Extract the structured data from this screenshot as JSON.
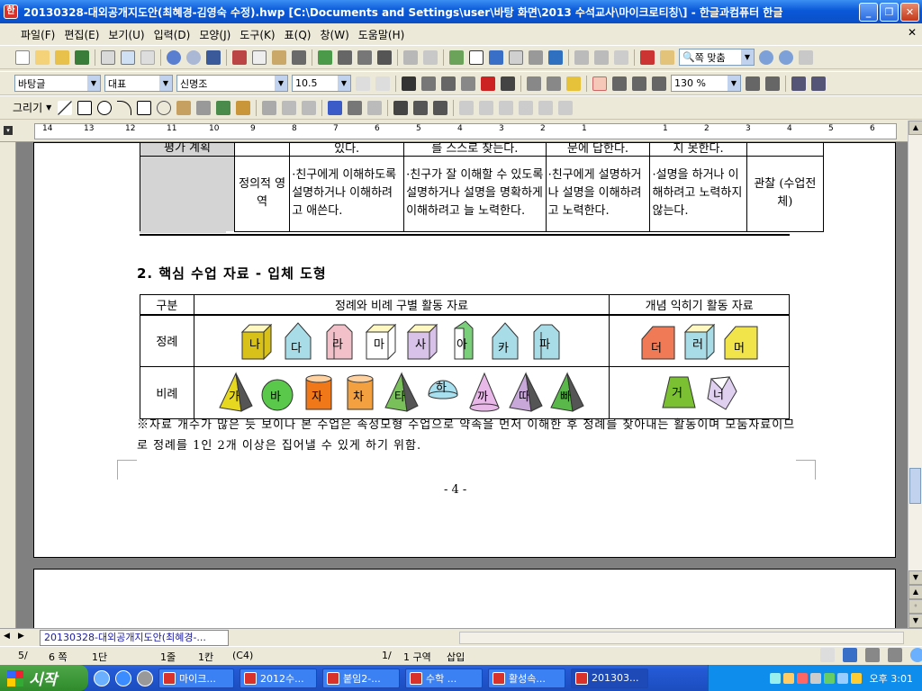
{
  "window": {
    "title": "20130328-대외공개지도안(최혜경-김영숙 수정).hwp [C:\\Documents and Settings\\user\\바탕 화면\\2013 수석교사\\마이크로티칭\\] - 한글과컴퓨터 한글",
    "min_label": "_",
    "max_label": "❐",
    "close_label": "✕"
  },
  "menu": {
    "items": [
      "파일(F)",
      "편집(E)",
      "보기(U)",
      "입력(D)",
      "모양(J)",
      "도구(K)",
      "표(Q)",
      "창(W)",
      "도움말(H)"
    ],
    "close": "✕"
  },
  "toolbar": {
    "zoom_combo": "쪽 맞춤",
    "style_combo": "바탕글",
    "font_lang_combo": "대표",
    "font_combo": "신명조",
    "size_combo": "10.5",
    "char_zoom_combo": "130 %",
    "draw_label": "그리기"
  },
  "ruler": {
    "ticks": [
      "14",
      "13",
      "12",
      "11",
      "10",
      "9",
      "8",
      "7",
      "6",
      "5",
      "4",
      "3",
      "2",
      "1",
      "1",
      "2",
      "3",
      "4",
      "5",
      "6"
    ]
  },
  "document": {
    "top_table": {
      "row1": [
        "평가 계획",
        "",
        "있다.",
        "를 스스로 찾는다.",
        "문에 답한다.",
        "지 못한다.",
        ""
      ],
      "row2": {
        "domain": "정의적 영역",
        "c1": "·친구에게 이해하도록 설명하거나 이해하려고 애쓴다.",
        "c2": "·친구가 잘 이해할 수 있도록 설명하거나 설명을 명확하게 이해하려고 늘 노력한다.",
        "c3": "·친구에게 설명하거나 설명을 이해하려고 노력한다.",
        "c4": "·설명을 하거나 이해하려고 노력하지 않는다.",
        "method": "관찰 (수업전체)"
      }
    },
    "section_title": "2. 핵심 수업 자료 - 입체 도형",
    "shape_table": {
      "header": [
        "구분",
        "정례와 비례 구별 활동 자료",
        "개념 익히기 활동 자료"
      ],
      "rows": [
        {
          "label": "정례",
          "group1": [
            "나",
            "다",
            "라",
            "마",
            "사",
            "아",
            "카",
            "파"
          ],
          "group2": [
            "더",
            "러",
            "머"
          ]
        },
        {
          "label": "비례",
          "group1": [
            "가",
            "바",
            "자",
            "차",
            "타",
            "하",
            "까",
            "따",
            "빠"
          ],
          "group2": [
            "거",
            "너"
          ]
        }
      ]
    },
    "note": "※자료 개수가 많은 듯 보이나 본 수업은 속성모형 수업으로 약속을 먼저 이해한 후 정례를 찾아내는 활동이며 모둠자료이므로 정례를 1인 2개 이상은 집어낼 수 있게 하기 위함.",
    "page_number": "- 4 -"
  },
  "doc_tab": "20130328-대외공개지도안(최혜경-...",
  "status": {
    "page": "5/",
    "pages": "6 쪽",
    "column": "1단",
    "line": "1줄",
    "col": "1칸",
    "cell": "(C4)",
    "section": "1/",
    "section_label": "1 구역",
    "mode": "삽입"
  },
  "taskbar": {
    "start": "시작",
    "tasks": [
      "마이크...",
      "2012수...",
      "붙임2-...",
      "수학 ...",
      "활성속...",
      "201303..."
    ],
    "clock": "오후 3:01"
  },
  "colors": {
    "title_bar": "#0a58d8",
    "taskbar": "#245ad6",
    "start_button": "#3a9a35"
  }
}
